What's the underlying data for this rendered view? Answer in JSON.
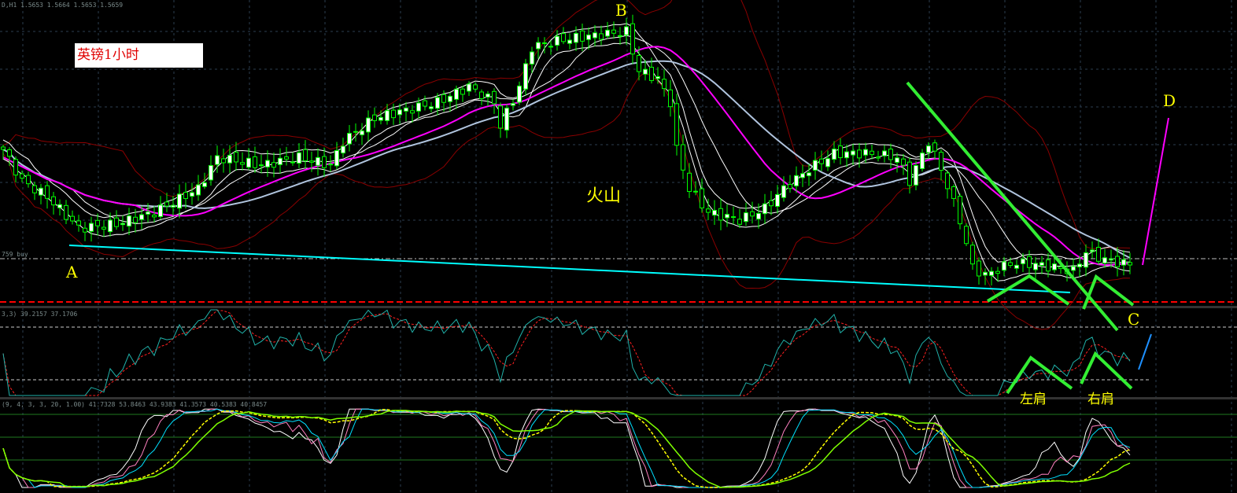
{
  "header": {
    "main_info": "D,H1 1.5653 1.5664 1.5653 1.5659",
    "rsi_info": "3,3) 39.2157 37.1706",
    "stoch_info": "(9, 4, 3, 3, 20, 1.00) 41.7328 53.8463 43.9383 41.3573 40.5383 40.8457",
    "order_label": "759 buy"
  },
  "title": "英镑1小时",
  "annotations": {
    "a": "A",
    "b": "B",
    "c": "C",
    "d": "D",
    "volcano": "火山",
    "left_shoulder": "左肩",
    "right_shoulder": "右肩"
  },
  "colors": {
    "background": "#000000",
    "candle_outline": "#00ff00",
    "bull_body": "#ffffff",
    "slow_ma": "#ff00ff",
    "mid_ma": "#b0c4de",
    "envelope": "#ffffff",
    "bollinger": "#8b0000",
    "trendline": "#00ffff",
    "pattern": "#33ff33",
    "support": "#ff0000",
    "rsi": "#20b2aa",
    "rsi_signal": "#ff2020"
  },
  "chart_data": {
    "type": "candlestick",
    "symbol": "GBP H1",
    "ylim": [
      1.5608,
      1.5996
    ],
    "bars": 180,
    "key_closes": [
      [
        0,
        1.5806
      ],
      [
        3,
        1.5766
      ],
      [
        7,
        1.5746
      ],
      [
        12,
        1.5706
      ],
      [
        18,
        1.5711
      ],
      [
        24,
        1.5726
      ],
      [
        31,
        1.5756
      ],
      [
        34,
        1.5796
      ],
      [
        41,
        1.5786
      ],
      [
        47,
        1.5796
      ],
      [
        52,
        1.5786
      ],
      [
        54,
        1.5816
      ],
      [
        59,
        1.5846
      ],
      [
        64,
        1.5856
      ],
      [
        69,
        1.5866
      ],
      [
        74,
        1.5886
      ],
      [
        78,
        1.5866
      ],
      [
        79,
        1.5836
      ],
      [
        82,
        1.5886
      ],
      [
        84,
        1.5936
      ],
      [
        89,
        1.5946
      ],
      [
        94,
        1.5951
      ],
      [
        99,
        1.5956
      ],
      [
        101,
        1.5906
      ],
      [
        104,
        1.5896
      ],
      [
        106,
        1.5866
      ],
      [
        107,
        1.5806
      ],
      [
        109,
        1.5756
      ],
      [
        112,
        1.5726
      ],
      [
        117,
        1.5716
      ],
      [
        121,
        1.5731
      ],
      [
        124,
        1.5756
      ],
      [
        128,
        1.5781
      ],
      [
        132,
        1.5801
      ],
      [
        137,
        1.5801
      ],
      [
        142,
        1.5796
      ],
      [
        144,
        1.5766
      ],
      [
        147,
        1.5816
      ],
      [
        149,
        1.5781
      ],
      [
        152,
        1.5716
      ],
      [
        154,
        1.5656
      ],
      [
        156,
        1.5646
      ],
      [
        160,
        1.5661
      ],
      [
        163,
        1.5661
      ],
      [
        167,
        1.5656
      ],
      [
        170,
        1.5651
      ],
      [
        172,
        1.5676
      ],
      [
        175,
        1.5666
      ],
      [
        179,
        1.5659
      ]
    ],
    "rsi_levels": [
      70,
      30
    ],
    "stoch_levels": [
      80,
      50,
      20
    ]
  }
}
